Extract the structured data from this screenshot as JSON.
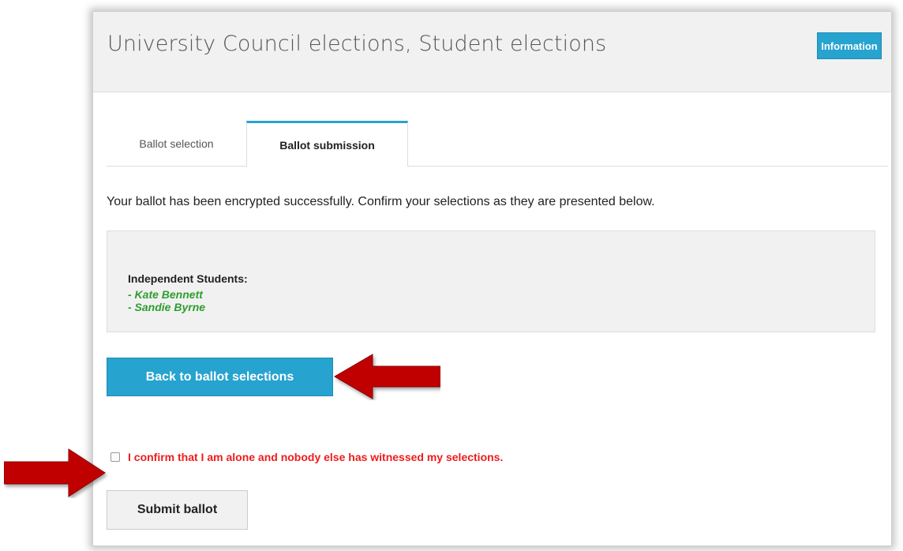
{
  "header": {
    "title": "University Council elections, Student elections",
    "info_button": "Information"
  },
  "tabs": [
    {
      "label": "Ballot selection",
      "active": false
    },
    {
      "label": "Ballot submission",
      "active": true
    }
  ],
  "intro_text": "Your ballot has been encrypted successfully. Confirm your selections as they are presented below.",
  "selections": {
    "group_title": "Independent Students:",
    "candidates": [
      "- Kate Bennett",
      "- Sandie Byrne"
    ]
  },
  "back_button": "Back to ballot selections",
  "confirm": {
    "label": "I confirm that I am alone and nobody else has witnessed my selections.",
    "checked": false
  },
  "submit_button": "Submit ballot",
  "colors": {
    "accent": "#27a3cf",
    "candidate": "#2e9e2e",
    "warning": "#ee1c1c",
    "annotation_arrow": "#c00000"
  },
  "icons": [
    "right-arrow-annotation-icon",
    "right-arrow-annotation-icon"
  ]
}
